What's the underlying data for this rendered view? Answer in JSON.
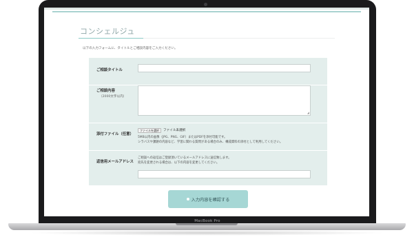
{
  "device": {
    "model_label": "MacBook Pro"
  },
  "page": {
    "heading": "コンシェルジュ",
    "intro": "以下の入力フォームに、タイトルとご相談内容をご入力ください。"
  },
  "form": {
    "title_label": "ご相談タイトル",
    "title_value": "",
    "content_label": "ご相談内容",
    "content_sublabel": "（2000文字以内）",
    "content_value": "",
    "attachment_label": "添付ファイル（任意）",
    "file_button_label": "ファイルを選択",
    "file_none_text": "ファイル未選択",
    "attachment_note_1": "5MB以内の画像（JPG、PNG、GIF）またはPDFを添付可能です。",
    "attachment_note_2": "シラバスや課題の内容など、学習に関わる質問がある場合のみ、構成資料の添付として利用してください。",
    "reply_email_label": "返信用メールアドレス",
    "reply_note_1": "ご相談への返信はご登録頂いているメールアドレスに送信致します。",
    "reply_note_2": "宛先を変更される場合は、以下の内容を変更してください。",
    "reply_email_value": ""
  },
  "submit": {
    "label": "入力内容を確認する"
  }
}
